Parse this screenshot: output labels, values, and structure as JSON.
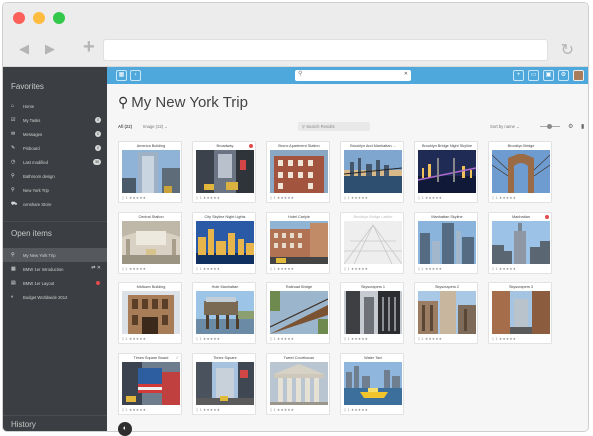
{
  "sidebar": {
    "favorites_heading": "Favorites",
    "favorites": [
      {
        "label": "Home",
        "icon": "home-icon",
        "glyph": "⌂"
      },
      {
        "label": "My Tasks",
        "icon": "tasks-icon",
        "glyph": "☑",
        "badge": "0"
      },
      {
        "label": "Messages",
        "icon": "envelope-icon",
        "glyph": "✉",
        "badge": "0"
      },
      {
        "label": "Pinboard",
        "icon": "pin-icon",
        "glyph": "✎",
        "badge": "0"
      },
      {
        "label": "Last modified",
        "icon": "clock-icon",
        "glyph": "◷",
        "badge": "30"
      },
      {
        "label": "Bathroom design",
        "icon": "search-icon",
        "glyph": "⚲"
      },
      {
        "label": "New York Trip",
        "icon": "search-icon",
        "glyph": "⚲"
      },
      {
        "label": "censhare Store",
        "icon": "cart-icon",
        "glyph": "⛟"
      }
    ],
    "open_heading": "Open items",
    "open_items": [
      {
        "label": "My New York Trip",
        "icon": "search-icon",
        "glyph": "⚲",
        "active": true
      },
      {
        "label": "BMW 1er Introduction",
        "icon": "film-icon",
        "glyph": "▦",
        "pair": "⇄ ✕"
      },
      {
        "label": "BMW 1er Layout",
        "icon": "document-icon",
        "glyph": "▤",
        "red": true
      },
      {
        "label": "Budget Worldwide 2014",
        "icon": "chart-icon",
        "glyph": "◐"
      }
    ],
    "history_heading": "History"
  },
  "topbar": {
    "search_placeholder": "⚲",
    "search_clear": "✕"
  },
  "main": {
    "title": "My New York Trip",
    "filter_all": "All (22)",
    "filter_images": "Image (22)  ⌄",
    "search_results_placeholder": "⚲ Search Results",
    "sort_label": "Sort by name  ⌄",
    "cards": [
      {
        "title": "America Building",
        "scene": "tower"
      },
      {
        "title": "Broadway",
        "scene": "street",
        "flag": true
      },
      {
        "title": "Bronx Apartment Station",
        "scene": "brick"
      },
      {
        "title": "Brooklyn And Manhattan ...",
        "scene": "bridge"
      },
      {
        "title": "Brooklyn Bridge Night Skyline",
        "scene": "night"
      },
      {
        "title": "Brooklyn Bridge",
        "scene": "arch"
      },
      {
        "title": "Central Station",
        "scene": "hall"
      },
      {
        "title": "City Skyline Night Lights",
        "scene": "skyline"
      },
      {
        "title": "Hotel Carlyle",
        "scene": "brick2"
      },
      {
        "title": "Brooklyn Bridge Lattice",
        "scene": "ghost"
      },
      {
        "title": "Manhattan Skyline",
        "scene": "towers"
      },
      {
        "title": "Manhattan",
        "scene": "empire",
        "flag": true
      },
      {
        "title": "Midtown Building",
        "scene": "building"
      },
      {
        "title": "Hole Manhattan",
        "scene": "pier"
      },
      {
        "title": "Railroad Bridge",
        "scene": "rail"
      },
      {
        "title": "Skyscrapers 1",
        "scene": "dark"
      },
      {
        "title": "Skyscrapers 2",
        "scene": "sky2"
      },
      {
        "title": "Skyscrapers 3",
        "scene": "sky3"
      },
      {
        "title": "Times Square Board",
        "scene": "flag",
        "check": true
      },
      {
        "title": "Times Square",
        "scene": "square"
      },
      {
        "title": "Tweet Courthouse",
        "scene": "court"
      },
      {
        "title": "Water Taxi",
        "scene": "taxi"
      }
    ],
    "card_meta": "▯ 1  ★★★★★"
  },
  "colors": {
    "sidebar_bg": "#3b3e42",
    "topbar_blue": "#4fa8dc",
    "flag_red": "#e04b4b"
  }
}
